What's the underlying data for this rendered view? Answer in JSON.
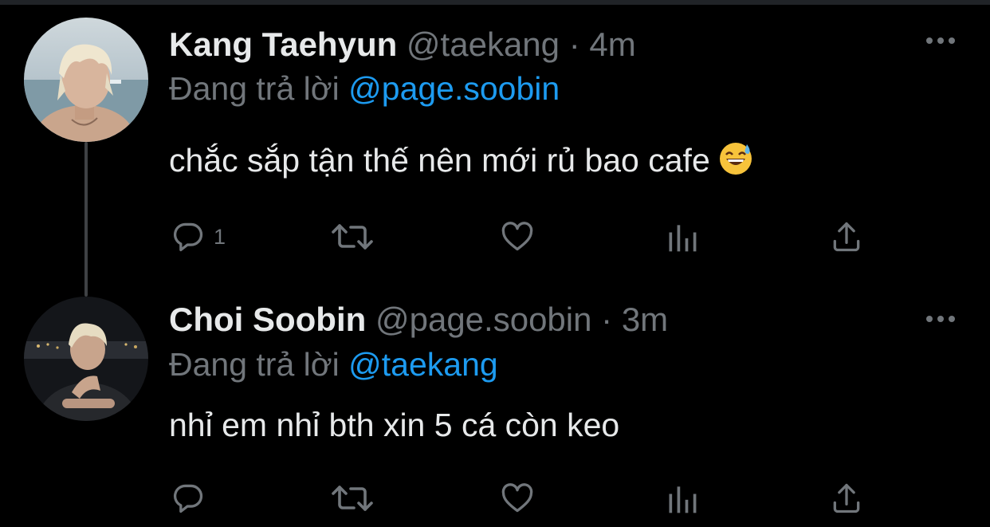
{
  "tweets": [
    {
      "display_name": "Kang Taehyun",
      "handle": "@taekang",
      "separator": "·",
      "time": "4m",
      "reply_prefix": "Đang trả lời",
      "reply_to": "@page.soobin",
      "text": "chắc sắp tận thế nên mới rủ bao cafe",
      "emoji": "grinning-face-with-sweat",
      "reply_count": "1",
      "retweet_count": "",
      "like_count": ""
    },
    {
      "display_name": "Choi Soobin",
      "handle": "@page.soobin",
      "separator": "·",
      "time": "3m",
      "reply_prefix": "Đang trả lời",
      "reply_to": "@taekang",
      "text": "nhỉ em nhỉ bth xin 5 cá còn keo",
      "reply_count": "",
      "retweet_count": "",
      "like_count": ""
    }
  ],
  "icons": {
    "reply": "reply-icon",
    "retweet": "retweet-icon",
    "like": "heart-icon",
    "views": "analytics-icon",
    "share": "share-icon",
    "more": "more-icon"
  },
  "colors": {
    "background": "#000000",
    "text": "#e7e9ea",
    "secondary": "#71767b",
    "link": "#1d9bf0",
    "thread_line": "#3e4144"
  }
}
